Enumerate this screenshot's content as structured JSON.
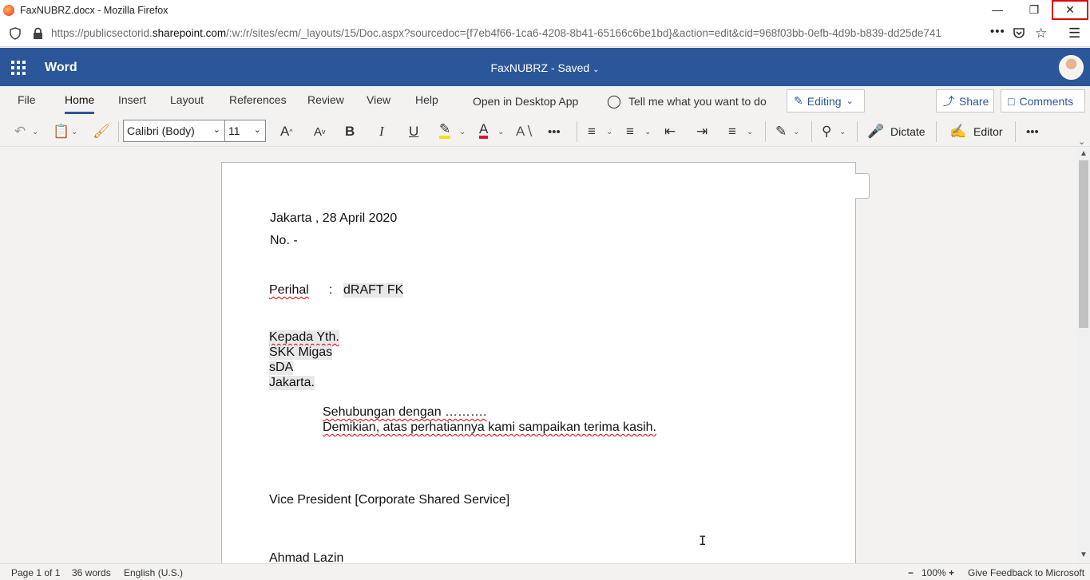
{
  "browser": {
    "window_title": "FaxNUBRZ.docx - Mozilla Firefox",
    "url_prefix": "https://publicsectorid.",
    "url_domain": "sharepoint.com",
    "url_suffix": "/:w:/r/sites/ecm/_layouts/15/Doc.aspx?sourcedoc={f7eb4f66-1ca6-4208-8b41-65166c6be1bd}&action=edit&cid=968f03bb-0efb-4d9b-b839-dd25de741",
    "page_actions": "•••"
  },
  "word": {
    "app_name": "Word",
    "doc_title": "FaxNUBRZ  -  Saved"
  },
  "ribbon": {
    "tabs": [
      "File",
      "Home",
      "Insert",
      "Layout",
      "References",
      "Review",
      "View",
      "Help"
    ],
    "open_desktop": "Open in Desktop App",
    "tell_me": "Tell me what you want to do",
    "editing": "Editing",
    "share": "Share",
    "comments": "Comments"
  },
  "toolbar": {
    "font_name": "Calibri (Body)",
    "font_size": "11",
    "dictate": "Dictate",
    "editor": "Editor"
  },
  "document": {
    "date_line": "Jakarta , 28 April 2020",
    "number_line": "No. -",
    "subject_label": "Perihal",
    "subject_colon": ":",
    "subject_value": "dRAFT FK",
    "recipient_1": "Kepada Yth.",
    "recipient_2": "SKK Migas",
    "recipient_3": "sDA",
    "recipient_4": "Jakarta.",
    "body_1": "Sehubungan dengan ……….",
    "body_2": "Demikian, atas perhatiannya kami sampaikan terima kasih.",
    "signature_title": "Vice President [Corporate Shared Service]",
    "signature_name": "Ahmad Lazin"
  },
  "status": {
    "page": "Page 1 of 1",
    "words": "36 words",
    "language": "English (U.S.)",
    "zoom": "100%",
    "feedback": "Give Feedback to Microsoft"
  }
}
